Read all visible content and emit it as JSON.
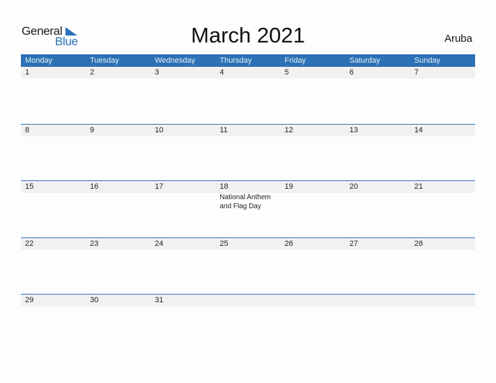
{
  "logo": {
    "text_general": "General",
    "text_blue": "Blue",
    "accent": "#2a72b8"
  },
  "title": "March 2021",
  "country": "Aruba",
  "colors": {
    "header_bg": "#2b71b4",
    "band_bg": "#f1f1f1"
  },
  "weekdays": [
    "Monday",
    "Tuesday",
    "Wednesday",
    "Thursday",
    "Friday",
    "Saturday",
    "Sunday"
  ],
  "weeks": [
    {
      "days": [
        {
          "num": "1"
        },
        {
          "num": "2"
        },
        {
          "num": "3"
        },
        {
          "num": "4"
        },
        {
          "num": "5"
        },
        {
          "num": "6"
        },
        {
          "num": "7"
        }
      ]
    },
    {
      "days": [
        {
          "num": "8"
        },
        {
          "num": "9"
        },
        {
          "num": "10"
        },
        {
          "num": "11"
        },
        {
          "num": "12"
        },
        {
          "num": "13"
        },
        {
          "num": "14"
        }
      ]
    },
    {
      "days": [
        {
          "num": "15"
        },
        {
          "num": "16"
        },
        {
          "num": "17"
        },
        {
          "num": "18",
          "event": "National Anthem and Flag Day"
        },
        {
          "num": "19"
        },
        {
          "num": "20"
        },
        {
          "num": "21"
        }
      ]
    },
    {
      "days": [
        {
          "num": "22"
        },
        {
          "num": "23"
        },
        {
          "num": "24"
        },
        {
          "num": "25"
        },
        {
          "num": "26"
        },
        {
          "num": "27"
        },
        {
          "num": "28"
        }
      ]
    },
    {
      "days": [
        {
          "num": "29"
        },
        {
          "num": "30"
        },
        {
          "num": "31"
        },
        {
          "num": ""
        },
        {
          "num": ""
        },
        {
          "num": ""
        },
        {
          "num": ""
        }
      ]
    }
  ]
}
